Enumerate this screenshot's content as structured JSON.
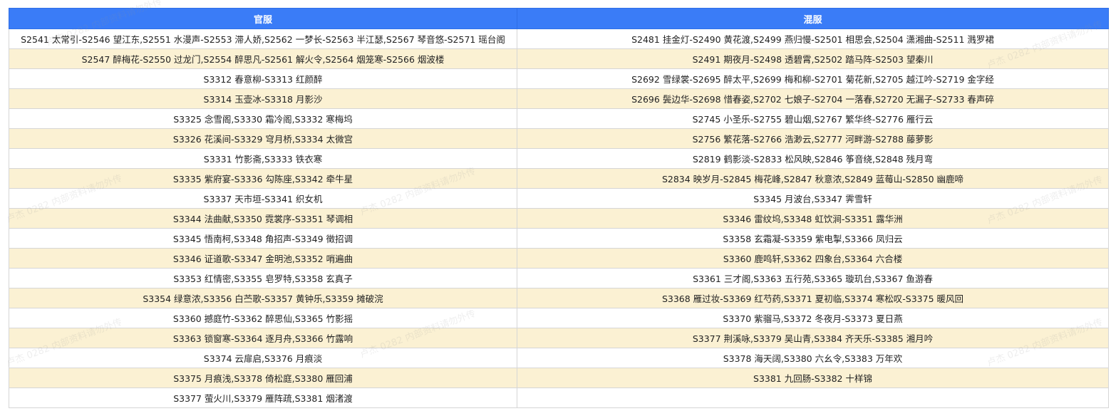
{
  "table": {
    "headers": [
      "官服",
      "混服"
    ],
    "rows": [
      [
        "S2541 太常引-S2546 望江东,S2551 水漫声-S2553 滞人娇,S2562 一梦长-S2563 半江瑟,S2567 琴音悠-S2571 瑶台阁",
        "S2481 挂金灯-S2490 黄花渡,S2499 燕归慢-S2501 相思会,S2504 潇湘曲-S2511 溅罗裙"
      ],
      [
        "S2547 醉梅花-S2550 过龙门,S2554 醉思凡-S2561 解火令,S2564 烟笼寒-S2566 烟波楼",
        "S2491 期夜月-S2498 透碧霄,S2502 踏马阵-S2503 望秦川"
      ],
      [
        "S3312 春意柳-S3313 红颜醉",
        "S2692 雪绿裳-S2695 醉太平,S2699 梅和柳-S2701 菊花新,S2705 越江吟-S2719 金字经"
      ],
      [
        "S3314 玉壶冰-S3318 月影沙",
        "S2696 鬓边华-S2698 惜春姿,S2702 七娘子-S2704 一落春,S2720 无漏子-S2733 春声碎"
      ],
      [
        "S3325 念雪阁,S3330 霜冷阁,S3332 寒梅坞",
        "S2745 小圣乐-S2755 碧山烟,S2767 繁华终-S2776 雁行云"
      ],
      [
        "S3326 花溪间-S3329 穹月桥,S3334 太微宫",
        "S2756 繁花落-S2766 浩渺云,S2777 河畔游-S2788 藤萝影"
      ],
      [
        "S3331 竹影斋,S3333 铁衣寒",
        "S2819 鹤影淡-S2833 松风映,S2846 筝音绕,S2848 残月弯"
      ],
      [
        "S3335 紫府宴-S3336 勾陈座,S3342 牵牛星",
        "S2834 映岁月-S2845 梅花峰,S2847 秋意浓,S2849 蓝莓山-S2850 幽鹿啼"
      ],
      [
        "S3337 天市垣-S3341 织女机",
        "S3345 月波台,S3347 霁雪轩"
      ],
      [
        "S3344 法曲献,S3350 霓裳序-S3351 琴调相",
        "S3346 雷纹坞,S3348 虹饮涧-S3351 露华洲"
      ],
      [
        "S3345 悟南柯,S3348 角招声-S3349 徵招调",
        "S3358 玄霜凝-S3359 紫电掣,S3366 凤归云"
      ],
      [
        "S3346 证道歌-S3347 金明池,S3352 哨遍曲",
        "S3360 鹿鸣轩,S3362 四象台,S3364 六合楼"
      ],
      [
        "S3353 红情密,S3355 皂罗特,S3358 玄真子",
        "S3361 三才阁,S3363 五行苑,S3365 璇玑台,S3367 鱼游春"
      ],
      [
        "S3354 绿意浓,S3356 白苎歌-S3357 黄钟乐,S3359 摊破浣",
        "S3368 雁过妆-S3369 红芍药,S3371 夏初临,S3374 寒松叹-S3375 暖风回"
      ],
      [
        "S3360 撼庭竹-S3362 醉思仙,S3365 竹影摇",
        "S3370 紫骝马,S3372 冬夜月-S3373 夏日燕"
      ],
      [
        "S3363 锁窗寒-S3364 逐月舟,S3366 竹露响",
        "S3377 荆溪咏,S3379 吴山青,S3384 齐天乐-S3385 湘月吟"
      ],
      [
        "S3374 云扉启,S3376 月痕淡",
        "S3378 海天阔,S3380 六幺令,S3383 万年欢"
      ],
      [
        "S3375 月痕浅,S3378 倚松庭,S3380 雁回浦",
        "S3381 九回肠-S3382 十样锦"
      ],
      [
        "S3377 萤火川,S3379 雁阵疏,S3381 烟渚渡",
        ""
      ]
    ]
  },
  "watermark": "卢杰 0282 内部资料请勿外传"
}
